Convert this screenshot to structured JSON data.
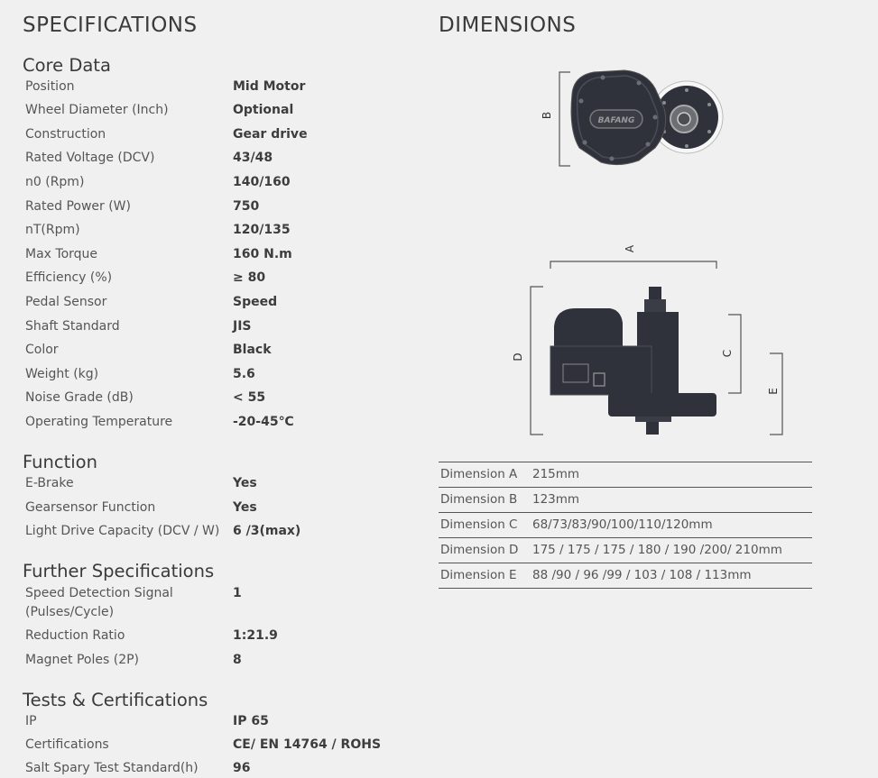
{
  "specifications": {
    "title": "SPECIFICATIONS",
    "sections": [
      {
        "heading": "Core Data",
        "rows": [
          {
            "label": "Position",
            "value": "Mid Motor"
          },
          {
            "label": "Wheel Diameter (Inch)",
            "value": "Optional"
          },
          {
            "label": "Construction",
            "value": "Gear drive"
          },
          {
            "label": "Rated Voltage (DCV)",
            "value": "43/48"
          },
          {
            "label": "n0 (Rpm)",
            "value": "140/160"
          },
          {
            "label": "Rated Power (W)",
            "value": "750"
          },
          {
            "label": "nT(Rpm)",
            "value": "120/135"
          },
          {
            "label": "Max Torque",
            "value": "160 N.m"
          },
          {
            "label": "Efficiency (%)",
            "value": "≥ 80"
          },
          {
            "label": "Pedal Sensor",
            "value": "Speed"
          },
          {
            "label": "Shaft Standard",
            "value": "JIS"
          },
          {
            "label": "Color",
            "value": "Black"
          },
          {
            "label": "Weight (kg)",
            "value": "5.6"
          },
          {
            "label": "Noise Grade (dB)",
            "value": "< 55"
          },
          {
            "label": "Operating Temperature",
            "value": "-20-45℃"
          }
        ]
      },
      {
        "heading": "Function",
        "rows": [
          {
            "label": "E-Brake",
            "value": "Yes"
          },
          {
            "label": "Gearsensor Function",
            "value": "Yes"
          },
          {
            "label": "Light Drive Capacity (DCV / W)",
            "value": "6 /3(max)"
          }
        ]
      },
      {
        "heading": "Further Specifications",
        "rows": [
          {
            "label": "Speed Detection Signal",
            "label2": "(Pulses/Cycle)",
            "value": "1"
          },
          {
            "label": "Reduction Ratio",
            "value": "1:21.9"
          },
          {
            "label": "Magnet Poles (2P)",
            "value": "8"
          }
        ]
      },
      {
        "heading": "Tests & Certifications",
        "rows": [
          {
            "label": "IP",
            "value": "IP 65"
          },
          {
            "label": "Certifications",
            "value": "CE/ EN 14764 / ROHS"
          },
          {
            "label": "Salt Spary Test Standard(h)",
            "value": "96"
          }
        ]
      }
    ]
  },
  "dimensions": {
    "title": "DIMENSIONS",
    "figure_labels": {
      "a": "A",
      "b": "B",
      "c": "C",
      "d": "D",
      "e": "E"
    },
    "logo_text": "BAFANG",
    "rows": [
      {
        "label": "Dimension A",
        "value": "215mm"
      },
      {
        "label": "Dimension B",
        "value": "123mm"
      },
      {
        "label": "Dimension C",
        "value": "68/73/83/90/100/110/120mm"
      },
      {
        "label": "Dimension D",
        "value": "175 / 175 / 175 / 180 / 190 /200/ 210mm"
      },
      {
        "label": "Dimension E",
        "value": "88 /90 / 96 /99 / 103 / 108 / 113mm"
      }
    ]
  }
}
